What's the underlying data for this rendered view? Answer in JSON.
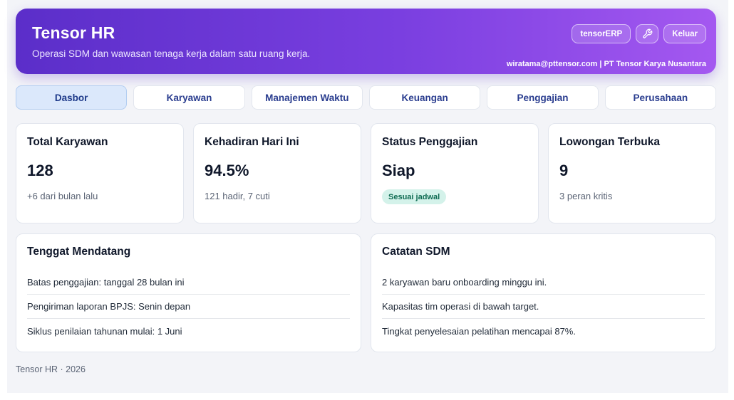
{
  "header": {
    "title": "Tensor HR",
    "subtitle": "Operasi SDM dan wawasan tenaga kerja dalam satu ruang kerja.",
    "erp_label": "tensorERP",
    "settings_icon": "wrench-icon",
    "logout_label": "Keluar",
    "user_line": "wiratama@pttensor.com | PT Tensor Karya Nusantara"
  },
  "tabs": [
    {
      "label": "Dasbor",
      "active": true
    },
    {
      "label": "Karyawan",
      "active": false
    },
    {
      "label": "Manajemen Waktu",
      "active": false
    },
    {
      "label": "Keuangan",
      "active": false
    },
    {
      "label": "Penggajian",
      "active": false
    },
    {
      "label": "Perusahaan",
      "active": false
    }
  ],
  "kpis": [
    {
      "title": "Total Karyawan",
      "value": "128",
      "sub": "+6 dari bulan lalu"
    },
    {
      "title": "Kehadiran Hari Ini",
      "value": "94.5%",
      "sub": "121 hadir, 7 cuti"
    },
    {
      "title": "Status Penggajian",
      "value": "Siap",
      "badge": "Sesuai jadwal"
    },
    {
      "title": "Lowongan Terbuka",
      "value": "9",
      "sub": "3 peran kritis"
    }
  ],
  "deadlines": {
    "title": "Tenggat Mendatang",
    "items": [
      "Batas penggajian: tanggal 28 bulan ini",
      "Pengiriman laporan BPJS: Senin depan",
      "Siklus penilaian tahunan mulai: 1 Juni"
    ]
  },
  "notes": {
    "title": "Catatan SDM",
    "items": [
      "2 karyawan baru onboarding minggu ini.",
      "Kapasitas tim operasi di bawah target.",
      "Tingkat penyelesaian pelatihan mencapai 87%."
    ]
  },
  "footer": {
    "text": "Tensor HR · 2026"
  },
  "colors": {
    "accent": "#6d36d9",
    "active_tab": "#dbe8fb",
    "badge_bg": "#d4f2ea"
  }
}
